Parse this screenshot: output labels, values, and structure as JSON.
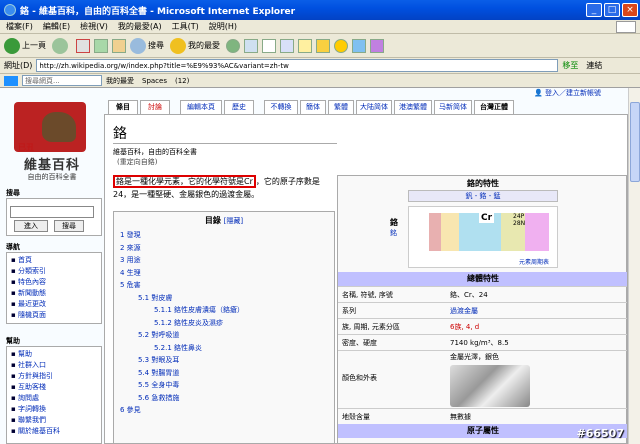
{
  "window": {
    "title": "鉻 - 維基百科，自由的百科全書 - Microsoft Internet Explorer"
  },
  "menu": [
    "檔案(F)",
    "編輯(E)",
    "檢視(V)",
    "我的最愛(A)",
    "工具(T)",
    "說明(H)"
  ],
  "toolbar": {
    "back": "上一頁",
    "search": "搜尋",
    "favorites": "我的最愛"
  },
  "address": {
    "label": "網址(D)",
    "url": "http://zh.wikipedia.org/w/index.php?title=%E9%93%AC&variant=zh-tw",
    "go": "移至",
    "links": "連結"
  },
  "searchbar": {
    "placeholder": "搜尋網頁...",
    "favorites": "我的最愛",
    "spaces": "Spaces",
    "count": "(12)"
  },
  "user": {
    "login": "登入／建立新帳號"
  },
  "tabs": [
    "條目",
    "討論",
    "編輯本頁",
    "歷史",
    "不轉換",
    "簡体",
    "繁體",
    "大陆简体",
    "港澳繁體",
    "马新简体",
    "台灣正體"
  ],
  "logo": {
    "cn": "已丑",
    "title": "維基百科",
    "subtitle": "自由的百科全書"
  },
  "sidebar": {
    "search_title": "搜尋",
    "go_button": "進入",
    "search_button": "搜尋",
    "nav_title": "導航",
    "nav_items": [
      "首頁",
      "分類索引",
      "特色內容",
      "新聞動態",
      "最近更改",
      "隨機頁面"
    ],
    "help_title": "幫助",
    "help_items": [
      "幫助",
      "社群入口",
      "方針與指引",
      "互助客棧",
      "詢問處",
      "字詞轉換",
      "聯繫我們",
      "關於維基百科"
    ]
  },
  "article": {
    "title": "鉻",
    "subtitle": "維基百科，自由的百科全書",
    "redirect": "(重定向自鉻)",
    "lead_highlight": "鉻是一種化學元素，它的化學符號是Cr",
    "lead_rest": "，它的原子序數是24，是一種堅硬、金屬銀色的過渡金屬。"
  },
  "toc": {
    "title": "目錄",
    "hide": "[隱藏]",
    "entries": [
      {
        "text": "1 發現",
        "level": 1
      },
      {
        "text": "2 來源",
        "level": 1
      },
      {
        "text": "3 用途",
        "level": 1
      },
      {
        "text": "4 生理",
        "level": 1
      },
      {
        "text": "5 危害",
        "level": 1
      },
      {
        "text": "5.1 對皮膚",
        "level": 2
      },
      {
        "text": "5.1.1 鉻性皮膚潰瘍（鉻瘡）",
        "level": 3
      },
      {
        "text": "5.1.2 鉻性皮炎及濕疹",
        "level": 3
      },
      {
        "text": "5.2 對呼吸道",
        "level": 2
      },
      {
        "text": "5.2.1 鉻性鼻炎",
        "level": 3
      },
      {
        "text": "5.3 對眼及耳",
        "level": 2
      },
      {
        "text": "5.4 對腸胃道",
        "level": 2
      },
      {
        "text": "5.5 全身中毒",
        "level": 2
      },
      {
        "text": "5.6 急救措施",
        "level": 2
      },
      {
        "text": "6 參見",
        "level": 1
      }
    ]
  },
  "infobox": {
    "title": "鉻的特性",
    "nav": "釩 - 鉻 - 錳",
    "element_name": "鉻",
    "element_pinyin": "銘",
    "symbol": "Cr",
    "number_info": "24P\n28N",
    "table_link": "元素周期表",
    "general_header": "總體特性",
    "rows": [
      {
        "k": "名稱, 符號, 序號",
        "v": "鉻、Cr、24"
      },
      {
        "k": "系列",
        "v": "過渡金屬",
        "link": true
      },
      {
        "k": "族, 周期, 元素分區",
        "v": "6族, 4, d",
        "red": true
      },
      {
        "k": "密度、硬度",
        "v": "7140 kg/m³、8.5"
      }
    ],
    "appearance_label": "顏色和外表",
    "appearance_value": "金屬光澤，銀色",
    "abundance_label": "地殼含量",
    "abundance_value": "無數據",
    "atomic_header": "原子屬性"
  },
  "watermark": "#66507"
}
